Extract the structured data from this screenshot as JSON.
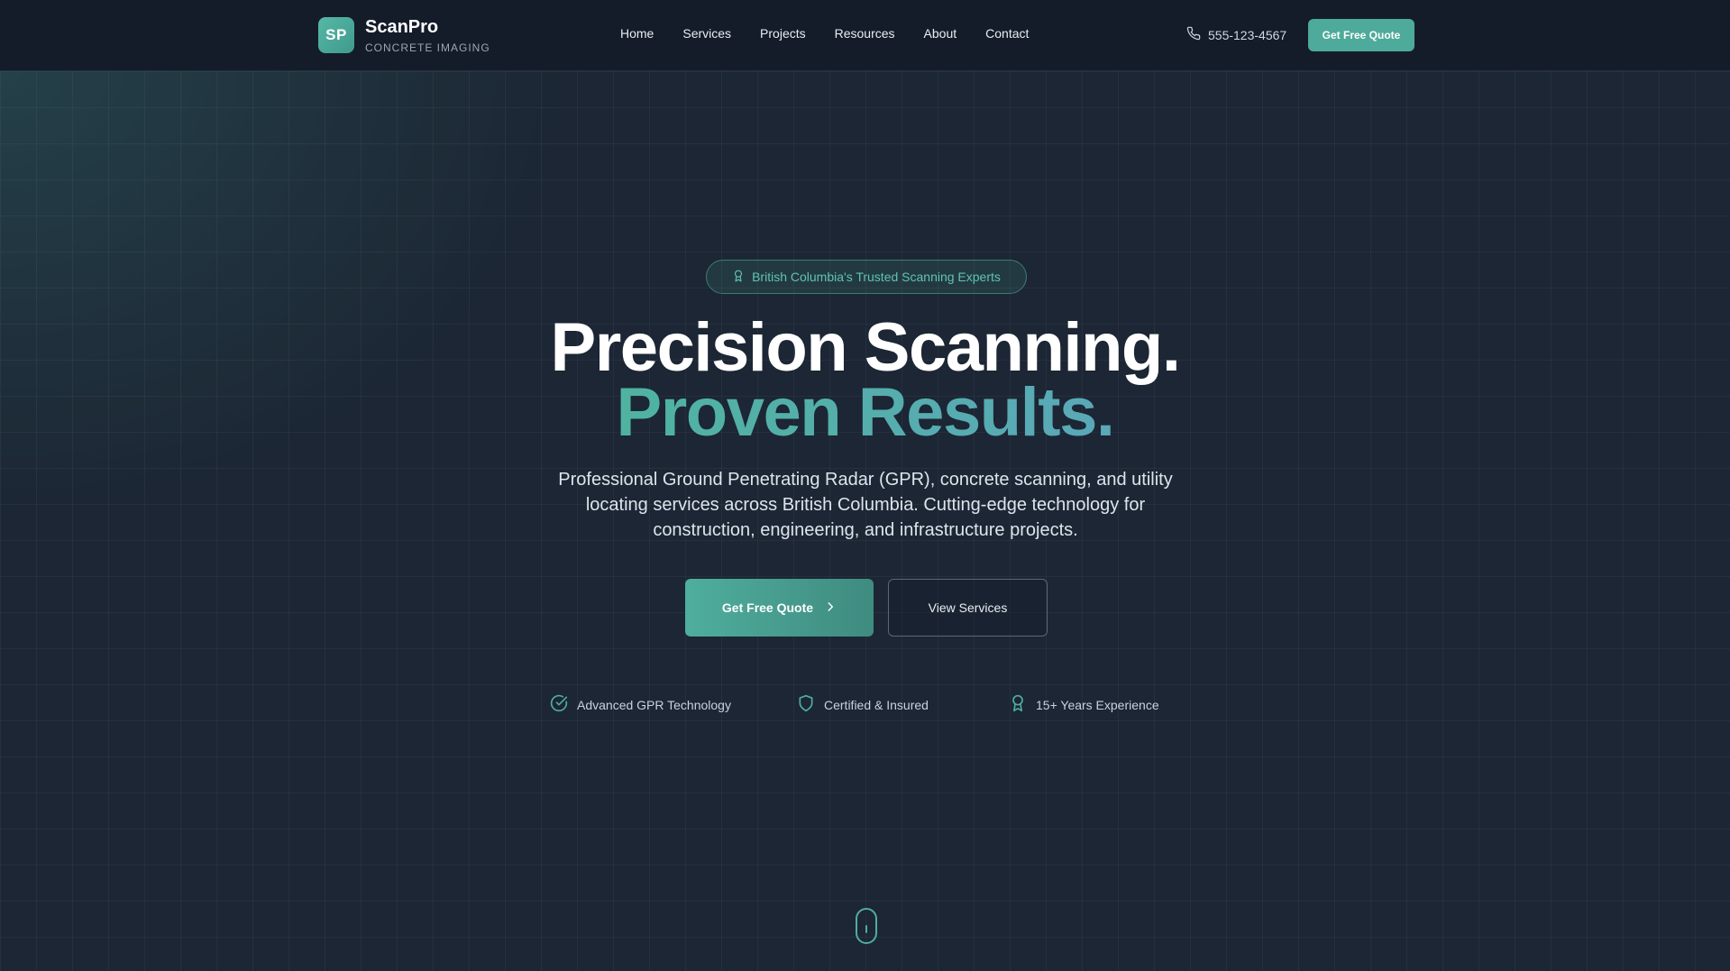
{
  "brand": {
    "badge": "SP",
    "name": "ScanPro",
    "tagline": "CONCRETE IMAGING"
  },
  "nav": {
    "items": [
      {
        "label": "Home"
      },
      {
        "label": "Services"
      },
      {
        "label": "Projects"
      },
      {
        "label": "Resources"
      },
      {
        "label": "About"
      },
      {
        "label": "Contact"
      }
    ]
  },
  "header": {
    "phone": "555-123-4567",
    "phone_icon": "phone-icon",
    "quote_label": "Get Free Quote"
  },
  "hero": {
    "badge_icon": "award-icon",
    "badge_text": "British Columbia's Trusted Scanning Experts",
    "headline_line1": "Precision Scanning.",
    "headline_line2": "Proven Results.",
    "lead": "Professional Ground Penetrating Radar (GPR), concrete scanning, and utility locating services across British Columbia. Cutting-edge technology for construction, engineering, and infrastructure projects.",
    "primary_cta": "Get Free Quote",
    "primary_cta_icon": "chevron-right-icon",
    "secondary_cta": "View Services",
    "features": [
      {
        "icon": "check-circle-icon",
        "label": "Advanced GPR Technology"
      },
      {
        "icon": "shield-icon",
        "label": "Certified & Insured"
      },
      {
        "icon": "award-icon",
        "label": "15+ Years Experience"
      }
    ],
    "scroll_icon": "mouse-scroll-icon"
  },
  "colors": {
    "accent": "#4eaa9a",
    "header_bg": "#141c2a",
    "page_bg": "#1c2634",
    "text_primary": "#ffffff"
  }
}
